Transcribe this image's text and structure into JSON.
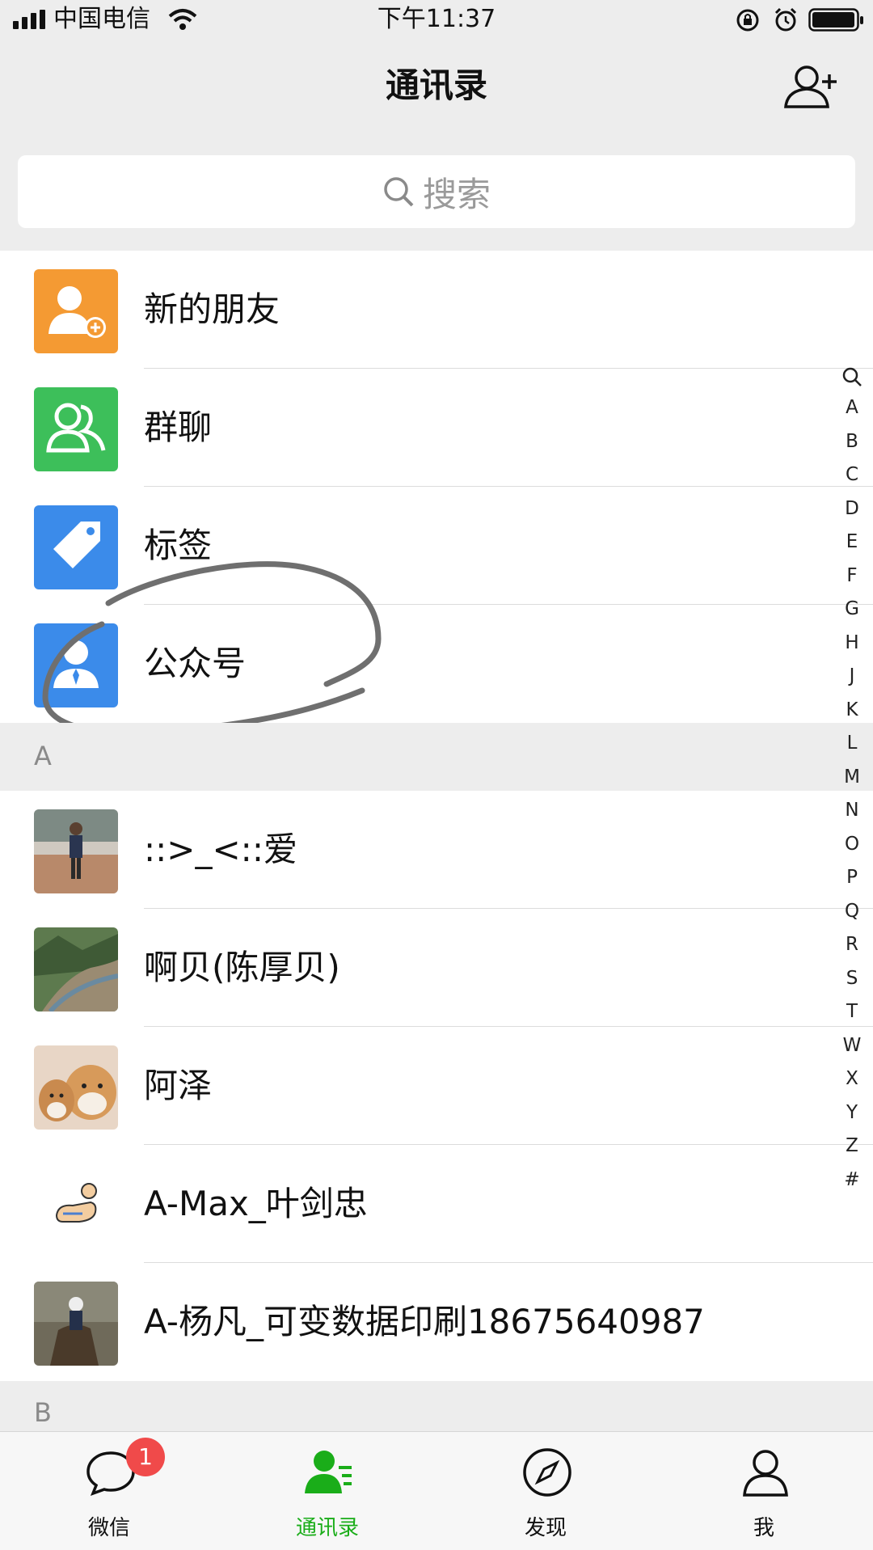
{
  "status_bar": {
    "carrier": "中国电信",
    "time": "下午11:37"
  },
  "header": {
    "title": "通讯录",
    "add_icon": "add-contact-icon"
  },
  "search": {
    "placeholder": "搜索"
  },
  "function_items": [
    {
      "label": "新的朋友",
      "icon": "new-friend-icon",
      "color": "#f49a33"
    },
    {
      "label": "群聊",
      "icon": "group-chat-icon",
      "color": "#3dbf5a"
    },
    {
      "label": "标签",
      "icon": "tag-icon",
      "color": "#3b8bea"
    },
    {
      "label": "公众号",
      "icon": "official-account-icon",
      "color": "#3b8bea"
    }
  ],
  "sections": [
    {
      "letter": "A",
      "contacts": [
        {
          "name": "::>_<::爱"
        },
        {
          "name": "啊贝(陈厚贝)"
        },
        {
          "name": "阿泽"
        },
        {
          "name": "A-Max_叶剑忠"
        },
        {
          "name": "A-杨凡_可变数据印刷18675640987"
        }
      ]
    },
    {
      "letter": "B",
      "contacts": []
    }
  ],
  "alphabet_index": [
    "A",
    "B",
    "C",
    "D",
    "E",
    "F",
    "G",
    "H",
    "J",
    "K",
    "L",
    "M",
    "N",
    "O",
    "P",
    "Q",
    "R",
    "S",
    "T",
    "W",
    "X",
    "Y",
    "Z",
    "#"
  ],
  "tab_bar": {
    "tabs": [
      {
        "label": "微信",
        "icon": "chat-icon",
        "active": false
      },
      {
        "label": "通讯录",
        "icon": "contacts-icon",
        "active": true
      },
      {
        "label": "发现",
        "icon": "compass-icon",
        "active": false
      },
      {
        "label": "我",
        "icon": "profile-icon",
        "active": false
      }
    ],
    "chat_badge": "1",
    "active_color": "#1aad19"
  }
}
